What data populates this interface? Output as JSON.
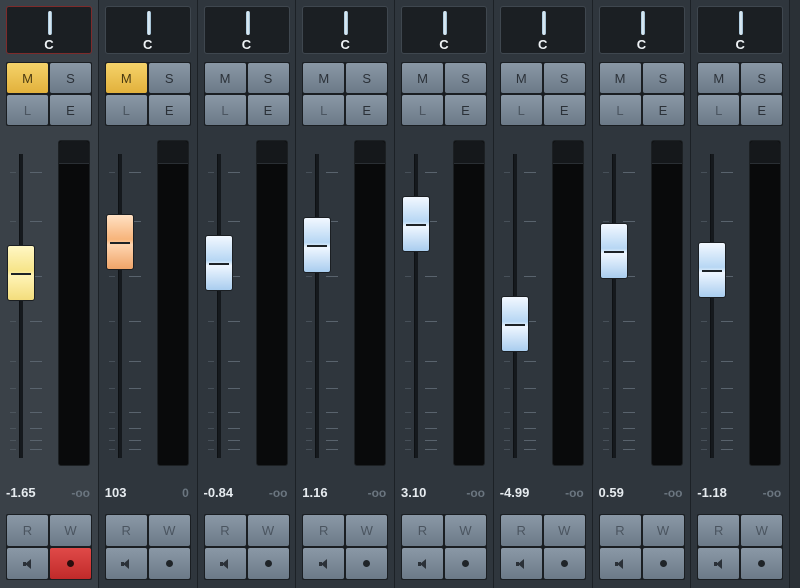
{
  "colors": {
    "background": "#2f363d",
    "selected_strip_bg": "#3a4148",
    "mute_active": "#e2b13c",
    "write_active": "#c02a2a",
    "fader_blue": "#b7d7f4",
    "fader_yellow": "#f7e58a",
    "fader_orange": "#f7b47a"
  },
  "channels": [
    {
      "pan": "C",
      "mute": "M",
      "solo": "S",
      "listen": "L",
      "edit": "E",
      "read": "R",
      "write": "W",
      "volume": "-1.65",
      "peak": "-oo",
      "fader_level": 0.61,
      "fader_color": "yellow",
      "mute_on": true,
      "write_on": true,
      "selected": true,
      "pan_selected": false,
      "monitor_icon": "speaker-icon",
      "record_icon": "record-dot-icon"
    },
    {
      "pan": "C",
      "mute": "M",
      "solo": "S",
      "listen": "L",
      "edit": "E",
      "read": "R",
      "write": "W",
      "volume": "103",
      "peak": "0",
      "fader_level": 0.71,
      "fader_color": "orange",
      "mute_on": true,
      "write_on": false,
      "selected": false,
      "pan_selected": true,
      "monitor_icon": "speaker-icon",
      "record_icon": "record-dot-icon"
    },
    {
      "pan": "C",
      "mute": "M",
      "solo": "S",
      "listen": "L",
      "edit": "E",
      "read": "R",
      "write": "W",
      "volume": "-0.84",
      "peak": "-oo",
      "fader_level": 0.64,
      "fader_color": "blue",
      "mute_on": false,
      "write_on": false,
      "selected": false,
      "pan_selected": false,
      "monitor_icon": "speaker-icon",
      "record_icon": "record-dot-icon"
    },
    {
      "pan": "C",
      "mute": "M",
      "solo": "S",
      "listen": "L",
      "edit": "E",
      "read": "R",
      "write": "W",
      "volume": "1.16",
      "peak": "-oo",
      "fader_level": 0.7,
      "fader_color": "blue",
      "mute_on": false,
      "write_on": false,
      "selected": false,
      "pan_selected": false,
      "monitor_icon": "speaker-icon",
      "record_icon": "record-dot-icon"
    },
    {
      "pan": "C",
      "mute": "M",
      "solo": "S",
      "listen": "L",
      "edit": "E",
      "read": "R",
      "write": "W",
      "volume": "3.10",
      "peak": "-oo",
      "fader_level": 0.77,
      "fader_color": "blue",
      "mute_on": false,
      "write_on": false,
      "selected": false,
      "pan_selected": false,
      "monitor_icon": "speaker-icon",
      "record_icon": "record-dot-icon"
    },
    {
      "pan": "C",
      "mute": "M",
      "solo": "S",
      "listen": "L",
      "edit": "E",
      "read": "R",
      "write": "W",
      "volume": "-4.99",
      "peak": "-oo",
      "fader_level": 0.44,
      "fader_color": "blue",
      "mute_on": false,
      "write_on": false,
      "selected": false,
      "pan_selected": false,
      "monitor_icon": "speaker-icon",
      "record_icon": "record-dot-icon"
    },
    {
      "pan": "C",
      "mute": "M",
      "solo": "S",
      "listen": "L",
      "edit": "E",
      "read": "R",
      "write": "W",
      "volume": "0.59",
      "peak": "-oo",
      "fader_level": 0.68,
      "fader_color": "blue",
      "mute_on": false,
      "write_on": false,
      "selected": false,
      "pan_selected": false,
      "monitor_icon": "speaker-icon",
      "record_icon": "record-dot-icon"
    },
    {
      "pan": "C",
      "mute": "M",
      "solo": "S",
      "listen": "L",
      "edit": "E",
      "read": "R",
      "write": "W",
      "volume": "-1.18",
      "peak": "-oo",
      "fader_level": 0.62,
      "fader_color": "blue",
      "mute_on": false,
      "write_on": false,
      "selected": false,
      "pan_selected": false,
      "monitor_icon": "speaker-icon",
      "record_icon": "record-dot-icon"
    }
  ]
}
